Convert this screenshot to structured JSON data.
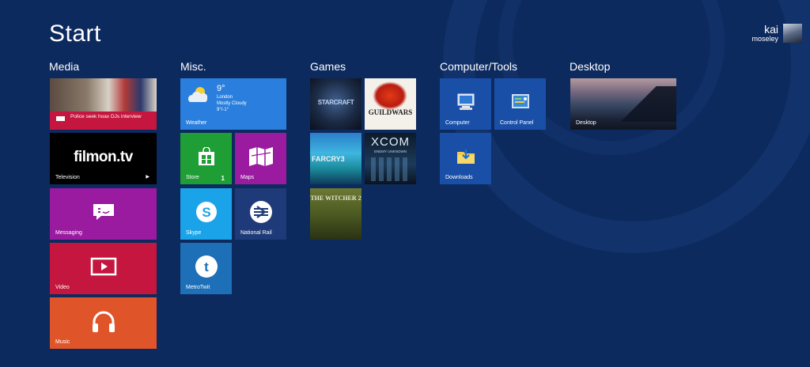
{
  "header": {
    "title": "Start"
  },
  "user": {
    "first_name": "kai",
    "last_name": "moseley"
  },
  "groups": [
    {
      "label": "Media"
    },
    {
      "label": "Misc."
    },
    {
      "label": "Games"
    },
    {
      "label": "Computer/Tools"
    },
    {
      "label": "Desktop"
    }
  ],
  "tiles": {
    "news": {
      "headline": "Police seek hoax DJs interview",
      "color": "#c4163e"
    },
    "filmon": {
      "logo": "filmon.tv",
      "label": "Television"
    },
    "messaging": {
      "label": "Messaging",
      "color": "#9a1aa0"
    },
    "video": {
      "label": "Video",
      "color": "#c4163e"
    },
    "music": {
      "label": "Music",
      "color": "#e0542a"
    },
    "weather": {
      "temp": "9°",
      "city": "London",
      "condition": "Mostly Cloudy",
      "range": "9°/-1°",
      "label": "Weather",
      "color": "#2a7fde"
    },
    "store": {
      "label": "Store",
      "badge": "1",
      "color": "#1e9e34"
    },
    "maps": {
      "label": "Maps",
      "color": "#9a1aa0"
    },
    "skype": {
      "label": "Skype",
      "color": "#1aa3e8"
    },
    "rail": {
      "label": "National Rail",
      "color": "#1e3a78"
    },
    "metrotwit": {
      "label": "MetroTwit",
      "color": "#1d6fb8"
    },
    "computer": {
      "label": "Computer",
      "color": "#1a4fa8"
    },
    "controlpanel": {
      "label": "Control Panel",
      "color": "#1a4fa8"
    },
    "downloads": {
      "label": "Downloads",
      "color": "#1a4fa8"
    },
    "desktop": {
      "label": "Desktop"
    },
    "starcraft": {
      "text": "STARCRAFT"
    },
    "guildwars": {
      "text": "GUILDWARS"
    },
    "farcry": {
      "text": "FARCRY3"
    },
    "xcom": {
      "text": "XCOM",
      "subtitle": "ENEMY UNKNOWN"
    },
    "witcher": {
      "text": "THE WITCHER 2"
    }
  }
}
